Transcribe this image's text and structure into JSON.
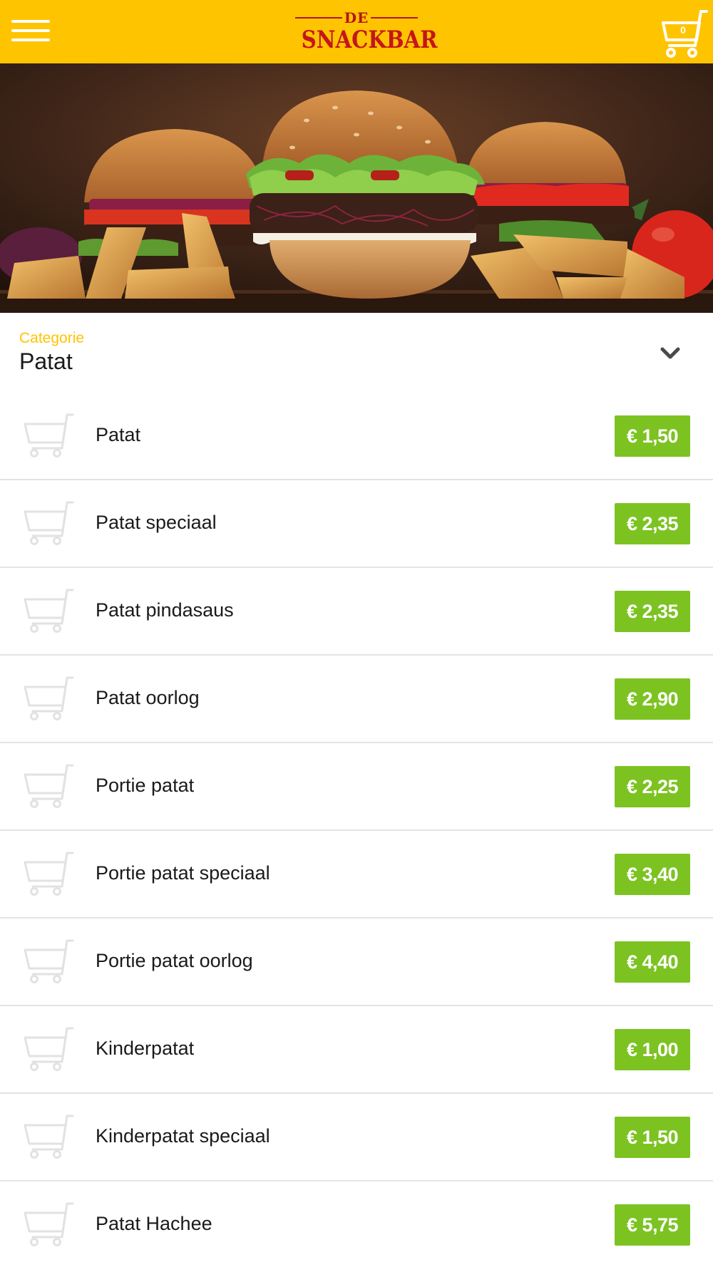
{
  "header": {
    "logo_top": "DE",
    "logo_main": "SNACKBAR",
    "cart_count": "0"
  },
  "category": {
    "label": "Categorie",
    "value": "Patat"
  },
  "products": [
    {
      "name": "Patat",
      "price": "€ 1,50"
    },
    {
      "name": "Patat speciaal",
      "price": "€ 2,35"
    },
    {
      "name": "Patat pindasaus",
      "price": "€ 2,35"
    },
    {
      "name": "Patat oorlog",
      "price": "€ 2,90"
    },
    {
      "name": "Portie patat",
      "price": "€ 2,25"
    },
    {
      "name": "Portie patat speciaal",
      "price": "€ 3,40"
    },
    {
      "name": "Portie patat oorlog",
      "price": "€ 4,40"
    },
    {
      "name": "Kinderpatat",
      "price": "€ 1,00"
    },
    {
      "name": "Kinderpatat speciaal",
      "price": "€ 1,50"
    },
    {
      "name": "Patat Hachee",
      "price": "€ 5,75"
    }
  ],
  "colors": {
    "header_bg": "#ffc400",
    "logo_red": "#c4161c",
    "price_green": "#7cc322",
    "category_label": "#ffc400"
  },
  "icons": {
    "menu": "hamburger-icon",
    "cart": "shopping-cart-icon",
    "dropdown": "chevron-down-icon",
    "row_cart": "add-to-cart-icon"
  }
}
